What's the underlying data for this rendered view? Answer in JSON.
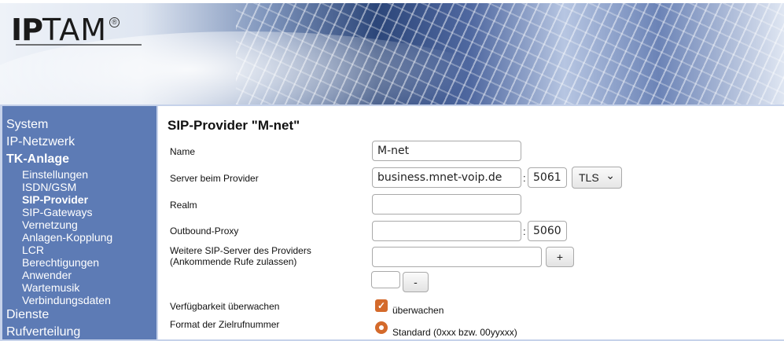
{
  "header": {
    "logo_bold": "IP",
    "logo_rest": "TAM",
    "logo_mark": "®"
  },
  "sidebar": {
    "items": [
      {
        "label": "System",
        "level": "top",
        "active": false
      },
      {
        "label": "IP-Netzwerk",
        "level": "top",
        "active": false
      },
      {
        "label": "TK-Anlage",
        "level": "top",
        "active": true
      },
      {
        "label": "Einstellungen",
        "level": "sub",
        "active": false
      },
      {
        "label": "ISDN/GSM",
        "level": "sub",
        "active": false
      },
      {
        "label": "SIP-Provider",
        "level": "sub",
        "active": true
      },
      {
        "label": "SIP-Gateways",
        "level": "sub",
        "active": false
      },
      {
        "label": "Vernetzung",
        "level": "sub",
        "active": false
      },
      {
        "label": "Anlagen-Kopplung",
        "level": "sub",
        "active": false
      },
      {
        "label": "LCR",
        "level": "sub",
        "active": false
      },
      {
        "label": "Berechtigungen",
        "level": "sub",
        "active": false
      },
      {
        "label": "Anwender",
        "level": "sub",
        "active": false
      },
      {
        "label": "Wartemusik",
        "level": "sub",
        "active": false
      },
      {
        "label": "Verbindungsdaten",
        "level": "sub",
        "active": false
      },
      {
        "label": "Dienste",
        "level": "top",
        "active": false
      },
      {
        "label": "Rufverteilung",
        "level": "top",
        "active": false
      }
    ]
  },
  "main": {
    "title": "SIP-Provider \"M-net\"",
    "name": {
      "label": "Name",
      "value": "M-net"
    },
    "server": {
      "label": "Server beim Provider",
      "host": "business.mnet-voip.de",
      "port": "5061",
      "transport": "TLS",
      "transport_arrow": "⌄"
    },
    "realm": {
      "label": "Realm",
      "value": ""
    },
    "outbound": {
      "label": "Outbound-Proxy",
      "host": "",
      "port": "5060"
    },
    "weitere": {
      "label_line1": "Weitere SIP-Server des Providers",
      "label_line2": "(Ankommende Rufe zulassen)",
      "value": "",
      "add_label": "+",
      "small_value": "",
      "remove_label": "-"
    },
    "verfuegbarkeit": {
      "label": "Verfügbarkeit überwachen",
      "checkbox_label": "überwachen",
      "checked": true
    },
    "format": {
      "label": "Format der Zielrufnummer",
      "option_label": "Standard (0xxx bzw. 00yyxxx)"
    }
  },
  "colors": {
    "sidebar": "#5d7bb5",
    "accent": "#d46a2b",
    "background": "#c6d2ea"
  },
  "separator": ":"
}
